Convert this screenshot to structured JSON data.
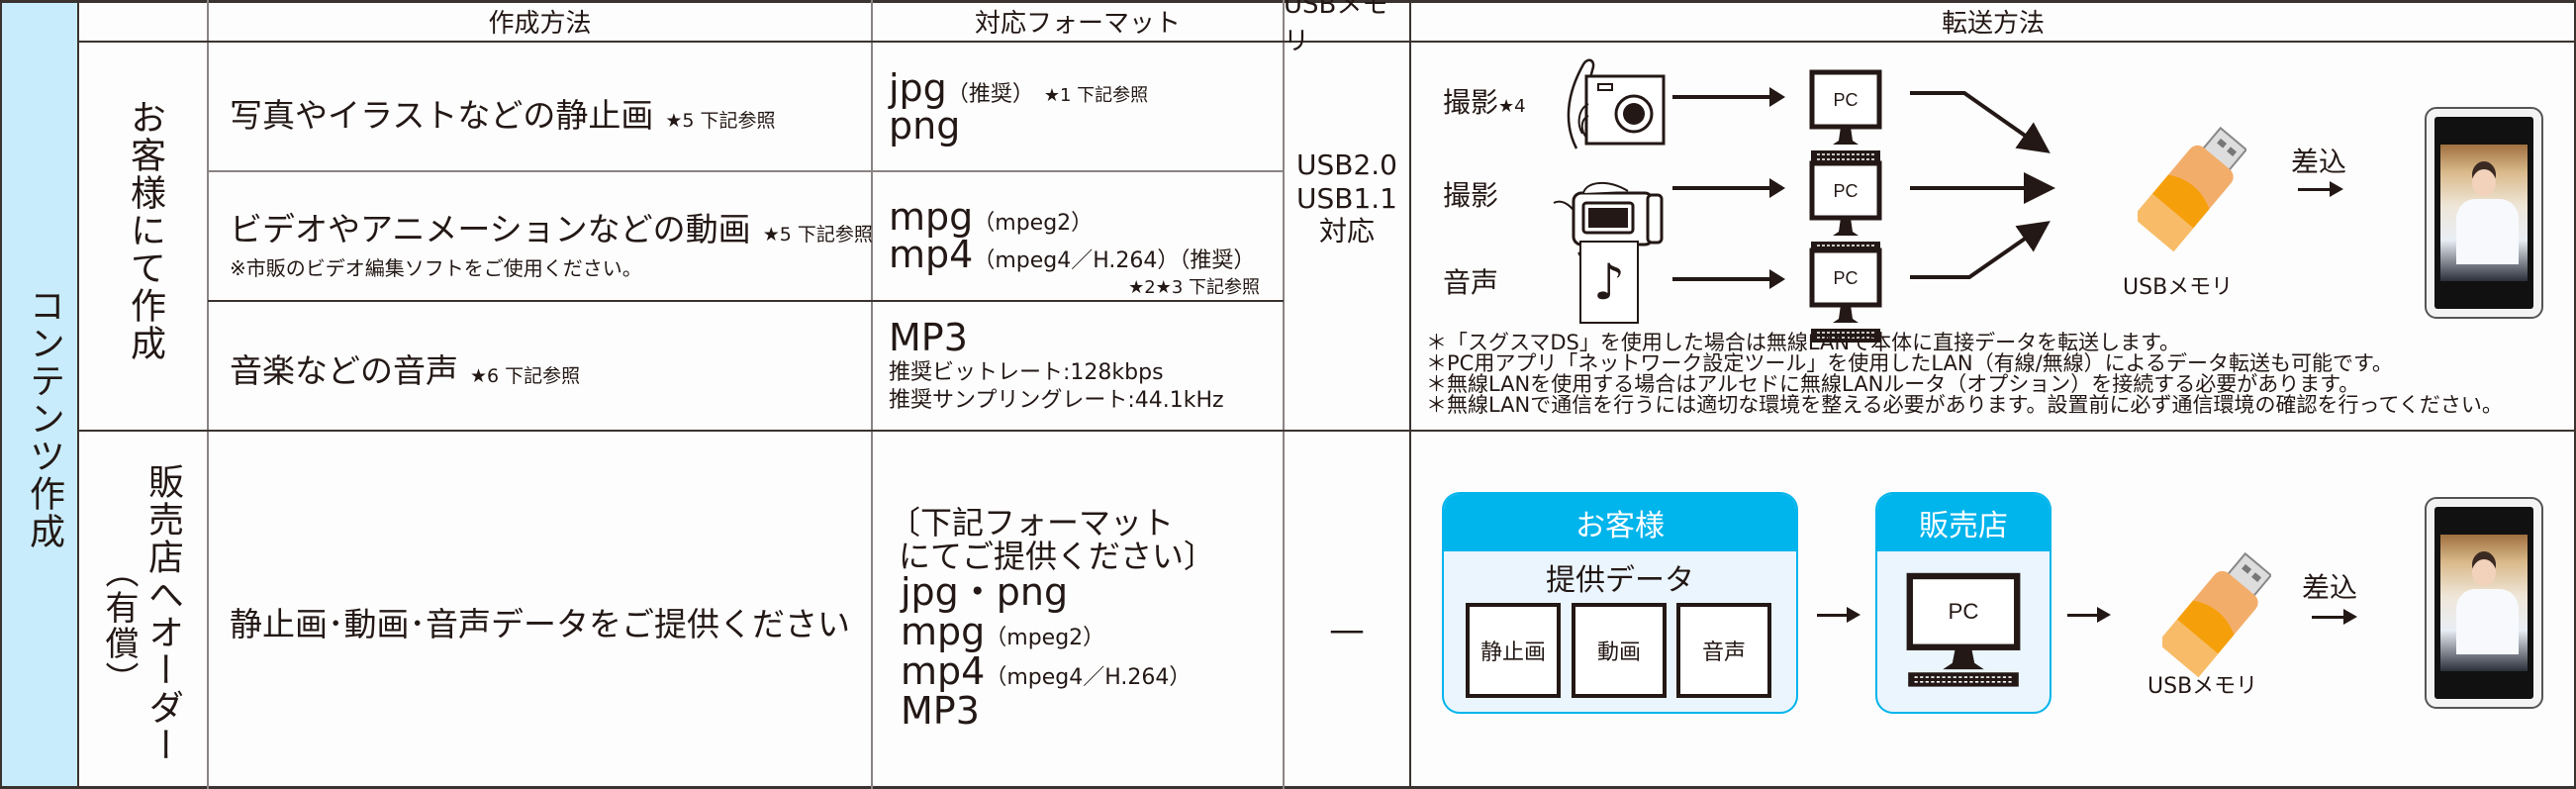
{
  "section_label": "コンテンツ作成",
  "headers": {
    "method": "作成方法",
    "format": "対応フォーマット",
    "usb": "USBメモリ",
    "transfer": "転送方法"
  },
  "customer_group": {
    "label": "お客様にて作成",
    "rows": [
      {
        "method": "写真やイラストなどの静止画",
        "method_ref": "★5 下記参照",
        "formats": [
          {
            "main": "jpg",
            "sub": "（推奨）",
            "ref": "★1 下記参照"
          },
          {
            "main": "png",
            "sub": "",
            "ref": ""
          }
        ]
      },
      {
        "method": "ビデオやアニメーションなどの動画",
        "method_ref": "★5 下記参照",
        "method_note": "※市販のビデオ編集ソフトをご使用ください。",
        "formats": [
          {
            "main": "mpg",
            "sub": "（mpeg2）"
          },
          {
            "main": "mp4",
            "sub": "（mpeg4／H.264）（推奨）"
          }
        ],
        "format_ref": "★2★3 下記参照"
      },
      {
        "method": "音楽などの音声",
        "method_ref": "★6 下記参照",
        "formats": [
          {
            "main": "MP3"
          }
        ],
        "format_details": [
          "推奨ビットレート:128kbps",
          "推奨サンプリングレート:44.1kHz"
        ]
      }
    ],
    "usb_support": [
      "USB2.0",
      "USB1.1",
      "対応"
    ],
    "transfer": {
      "sources": [
        {
          "label": "撮影",
          "ref": "★4",
          "icon": "camera-icon"
        },
        {
          "label": "撮影",
          "ref": "",
          "icon": "video-camera-icon"
        },
        {
          "label": "音声",
          "ref": "",
          "icon": "music-note-icon"
        }
      ],
      "pc_label": "PC",
      "usb_label": "USBメモリ",
      "insert_label": "差込",
      "notes": [
        "＊「スグスマDS」を使用した場合は無線LANで本体に直接データを転送します。",
        "＊PC用アプリ「ネットワーク設定ツール」を使用したLAN（有線/無線）によるデータ転送も可能です。",
        "＊無線LANを使用する場合はアルセドに無線LANルータ（オプション）を接続する必要があります。",
        "＊無線LANで通信を行うには適切な環境を整える必要があります。設置前に必ず通信環境の確認を行ってください。"
      ]
    }
  },
  "shop_group": {
    "label": "販売店へオーダー",
    "label_sub": "（有償）",
    "method": "静止画･動画･音声データをご提供ください",
    "format_intro": [
      "〔下記フォーマット",
      "にてご提供ください〕"
    ],
    "formats": [
      {
        "main": "jpg・png",
        "sub": ""
      },
      {
        "main": "mpg",
        "sub": "（mpeg2）"
      },
      {
        "main": "mp4",
        "sub": "（mpeg4／H.264）"
      },
      {
        "main": "MP3",
        "sub": ""
      }
    ],
    "usb_support": "—",
    "transfer": {
      "customer_box_title": "お客様",
      "provided_data_label": "提供データ",
      "data_items": [
        "静止画",
        "動画",
        "音声"
      ],
      "shop_box_title": "販売店",
      "pc_label": "PC",
      "usb_label": "USBメモリ",
      "insert_label": "差込"
    }
  },
  "colors": {
    "section_bg": "#c8ecfb",
    "box_header": "#00b4ec",
    "box_body": "#eaf5fd",
    "usb_orange": "#f5a623"
  }
}
